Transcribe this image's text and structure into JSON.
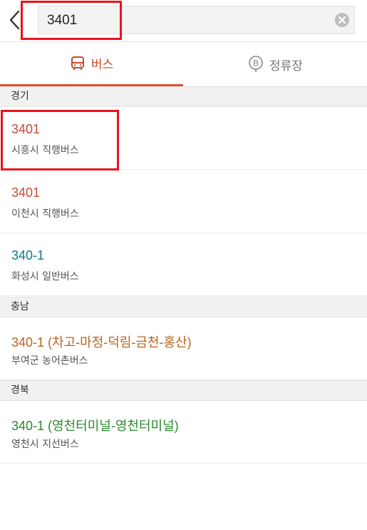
{
  "search": {
    "value": "3401",
    "placeholder": ""
  },
  "tabs": [
    {
      "label": "버스",
      "icon": "bus-icon",
      "active": true
    },
    {
      "label": "정류장",
      "icon": "bus-stop-icon",
      "active": false
    }
  ],
  "sections": [
    {
      "title": "경기",
      "items": [
        {
          "number": "3401",
          "desc": "시흥시 직행버스",
          "color": "#c64b36"
        },
        {
          "number": "3401",
          "desc": "이천시 직행버스",
          "color": "#c64b36"
        },
        {
          "number": "340-1",
          "desc": "화성시 일반버스",
          "color": "#117a83"
        }
      ]
    },
    {
      "title": "충남",
      "items": [
        {
          "number": "340-1 (차고-마정-덕림-금천-홍산)",
          "desc": "부여군 농어촌버스",
          "color": "#b9651e"
        }
      ]
    },
    {
      "title": "경북",
      "items": [
        {
          "number": "340-1 (영천터미널-영천터미널)",
          "desc": "영천시 지선버스",
          "color": "#2b8a2b"
        }
      ]
    }
  ],
  "colors": {
    "accent": "#d5532d",
    "highlight_box": "#e8141b"
  }
}
